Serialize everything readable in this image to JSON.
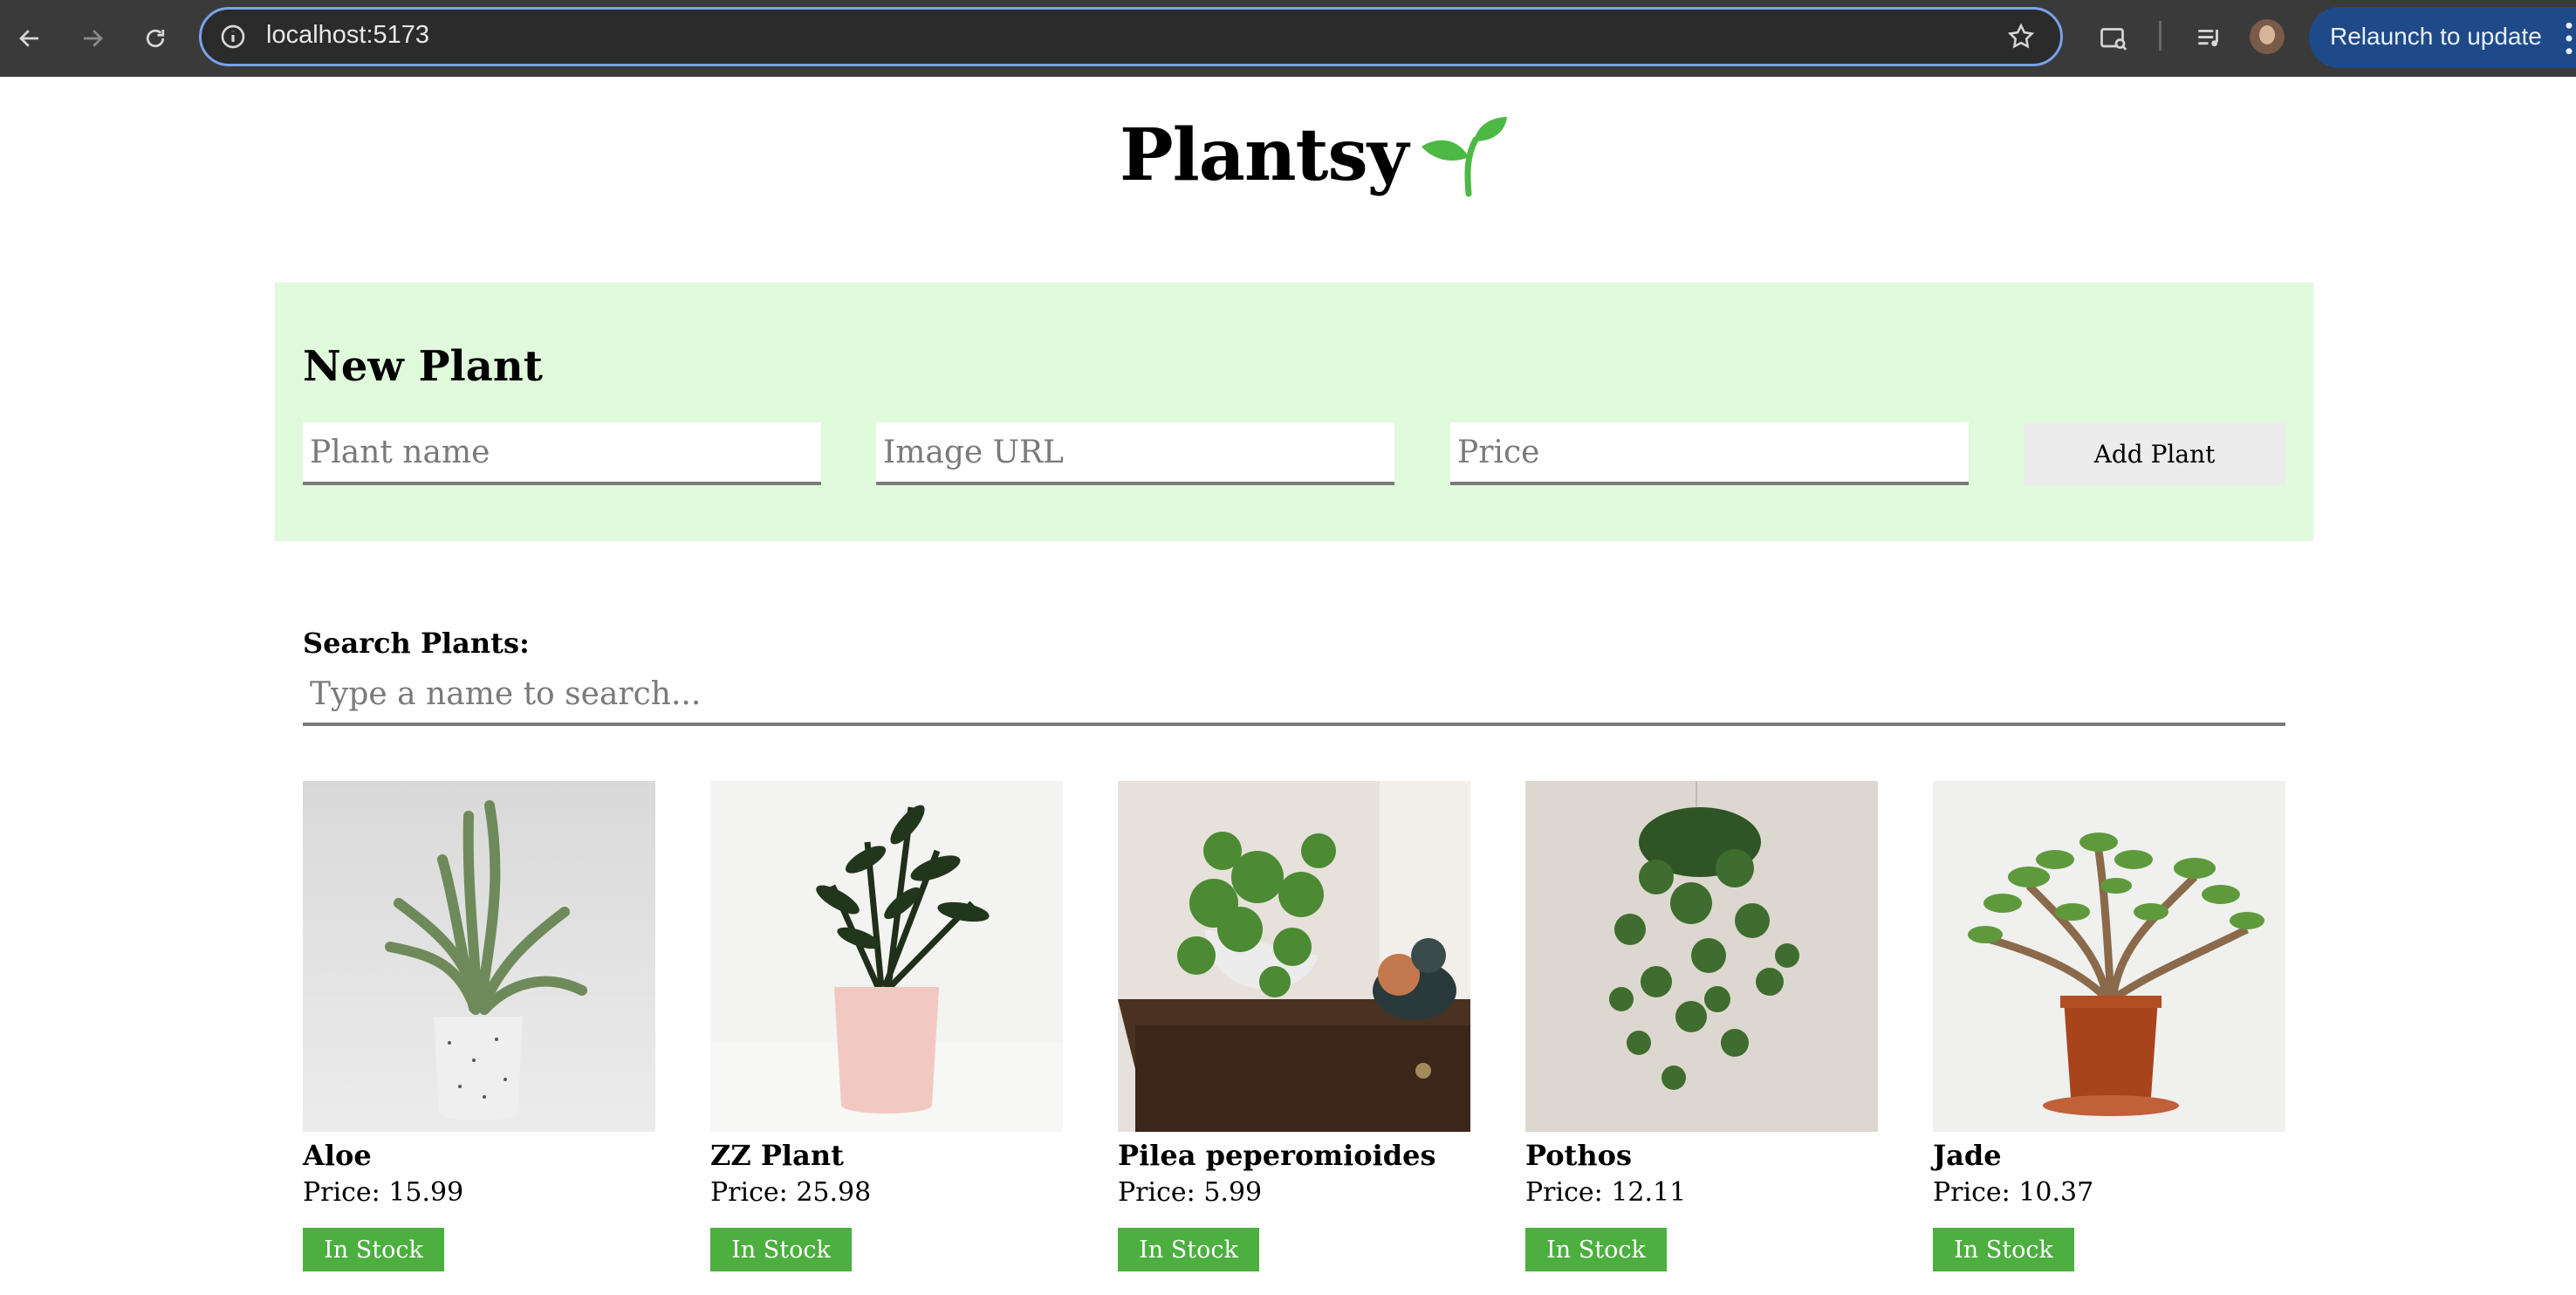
{
  "browser": {
    "url": "localhost:5173",
    "relaunch_label": "Relaunch to update"
  },
  "app": {
    "title": "Plantsy"
  },
  "new_plant_form": {
    "heading": "New Plant",
    "name_placeholder": "Plant name",
    "image_placeholder": "Image URL",
    "price_placeholder": "Price",
    "submit_label": "Add Plant"
  },
  "search": {
    "label": "Search Plants:",
    "placeholder": "Type a name to search..."
  },
  "plants": [
    {
      "name": "Aloe",
      "price_text": "Price: 15.99",
      "stock_label": "In Stock"
    },
    {
      "name": "ZZ Plant",
      "price_text": "Price: 25.98",
      "stock_label": "In Stock"
    },
    {
      "name": "Pilea peperomioides",
      "price_text": "Price: 5.99",
      "stock_label": "In Stock"
    },
    {
      "name": "Pothos",
      "price_text": "Price: 12.11",
      "stock_label": "In Stock"
    },
    {
      "name": "Jade",
      "price_text": "Price: 10.37",
      "stock_label": "In Stock"
    }
  ],
  "colors": {
    "form_background": "#e0fadc",
    "stock_button": "#4caf3f",
    "logo_sprout": "#4cb944"
  }
}
